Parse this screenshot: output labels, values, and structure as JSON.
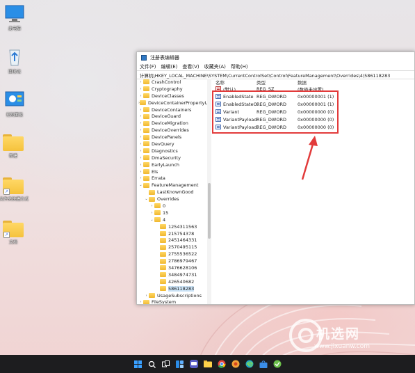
{
  "desktop": {
    "icons": [
      {
        "label": "此电脑",
        "icon": "computer-icon"
      },
      {
        "label": "回收站",
        "icon": "recycle-bin-icon"
      },
      {
        "label": "控制面板",
        "icon": "control-panel-icon"
      },
      {
        "label": "新建",
        "icon": "folder-icon"
      },
      {
        "label": "文件夹快捷方式",
        "icon": "folder-shortcut-icon"
      },
      {
        "label": "文档",
        "icon": "folder-shortcut-icon"
      }
    ]
  },
  "regedit": {
    "title": "注册表编辑器",
    "menu": [
      "文件(F)",
      "编辑(E)",
      "查看(V)",
      "收藏夹(A)",
      "帮助(H)"
    ],
    "address": "计算机\\HKEY_LOCAL_MACHINE\\SYSTEM\\CurrentControlSet\\Control\\FeatureManagement\\Overrides\\4\\586118283",
    "tree": [
      {
        "label": "CrashControl",
        "depth": 0,
        "expander": "›",
        "selected": false
      },
      {
        "label": "Cryptography",
        "depth": 0,
        "expander": "›",
        "selected": false
      },
      {
        "label": "DeviceClasses",
        "depth": 0,
        "expander": "›",
        "selected": false
      },
      {
        "label": "DeviceContainerPropertyUpda",
        "depth": 0,
        "expander": "›",
        "selected": false
      },
      {
        "label": "DeviceContainers",
        "depth": 0,
        "expander": "›",
        "selected": false
      },
      {
        "label": "DeviceGuard",
        "depth": 0,
        "expander": "›",
        "selected": false
      },
      {
        "label": "DeviceMigration",
        "depth": 0,
        "expander": "›",
        "selected": false
      },
      {
        "label": "DeviceOverrides",
        "depth": 0,
        "expander": "›",
        "selected": false
      },
      {
        "label": "DevicePanels",
        "depth": 0,
        "expander": "›",
        "selected": false
      },
      {
        "label": "DevQuery",
        "depth": 0,
        "expander": "›",
        "selected": false
      },
      {
        "label": "Diagnostics",
        "depth": 0,
        "expander": "›",
        "selected": false
      },
      {
        "label": "DmaSecurity",
        "depth": 0,
        "expander": "›",
        "selected": false
      },
      {
        "label": "EarlyLaunch",
        "depth": 0,
        "expander": "›",
        "selected": false
      },
      {
        "label": "Els",
        "depth": 0,
        "expander": "›",
        "selected": false
      },
      {
        "label": "Errata",
        "depth": 0,
        "expander": "›",
        "selected": false
      },
      {
        "label": "FeatureManagement",
        "depth": 0,
        "expander": "⌄",
        "selected": false
      },
      {
        "label": "LastKnownGood",
        "depth": 1,
        "expander": "",
        "selected": false
      },
      {
        "label": "Overrides",
        "depth": 1,
        "expander": "⌄",
        "selected": false
      },
      {
        "label": "0",
        "depth": 2,
        "expander": "›",
        "selected": false
      },
      {
        "label": "15",
        "depth": 2,
        "expander": "›",
        "selected": false
      },
      {
        "label": "4",
        "depth": 2,
        "expander": "⌄",
        "selected": false
      },
      {
        "label": "1254311563",
        "depth": 3,
        "expander": "",
        "selected": false
      },
      {
        "label": "215754378",
        "depth": 3,
        "expander": "",
        "selected": false
      },
      {
        "label": "2451464331",
        "depth": 3,
        "expander": "",
        "selected": false
      },
      {
        "label": "2570495115",
        "depth": 3,
        "expander": "",
        "selected": false
      },
      {
        "label": "2755536522",
        "depth": 3,
        "expander": "",
        "selected": false
      },
      {
        "label": "2786979467",
        "depth": 3,
        "expander": "",
        "selected": false
      },
      {
        "label": "3476628106",
        "depth": 3,
        "expander": "",
        "selected": false
      },
      {
        "label": "3484974731",
        "depth": 3,
        "expander": "",
        "selected": false
      },
      {
        "label": "426540682",
        "depth": 3,
        "expander": "",
        "selected": false
      },
      {
        "label": "586118283",
        "depth": 3,
        "expander": "",
        "selected": true
      },
      {
        "label": "UsageSubscriptions",
        "depth": 1,
        "expander": "›",
        "selected": false
      },
      {
        "label": "FileSystem",
        "depth": 0,
        "expander": "›",
        "selected": false
      }
    ],
    "columns": {
      "name": "名称",
      "type": "类型",
      "data": "数据"
    },
    "values": [
      {
        "name": "(默认)",
        "type": "REG_SZ",
        "data": "(数值未设置)",
        "kind": "sz"
      },
      {
        "name": "EnabledState",
        "type": "REG_DWORD",
        "data": "0x00000001 (1)",
        "kind": "dword"
      },
      {
        "name": "EnabledStateO...",
        "type": "REG_DWORD",
        "data": "0x00000001 (1)",
        "kind": "dword"
      },
      {
        "name": "Variant",
        "type": "REG_DWORD",
        "data": "0x00000000 (0)",
        "kind": "dword"
      },
      {
        "name": "VariantPayload",
        "type": "REG_DWORD",
        "data": "0x00000000 (0)",
        "kind": "dword"
      },
      {
        "name": "VariantPayload...",
        "type": "REG_DWORD",
        "data": "0x00000000 (0)",
        "kind": "dword"
      }
    ]
  },
  "annotation": {
    "box_color": "#e23b3b",
    "arrow_color": "#e23b3b"
  },
  "watermark": {
    "text": "机选网",
    "url": "www.jixuanw.com"
  },
  "taskbar": {
    "icons": [
      "start-icon",
      "search-icon",
      "task-view-icon",
      "widgets-icon",
      "chat-icon",
      "file-explorer-icon",
      "chrome-icon",
      "browser-icon",
      "edge-icon",
      "store-icon",
      "app-icon"
    ]
  }
}
